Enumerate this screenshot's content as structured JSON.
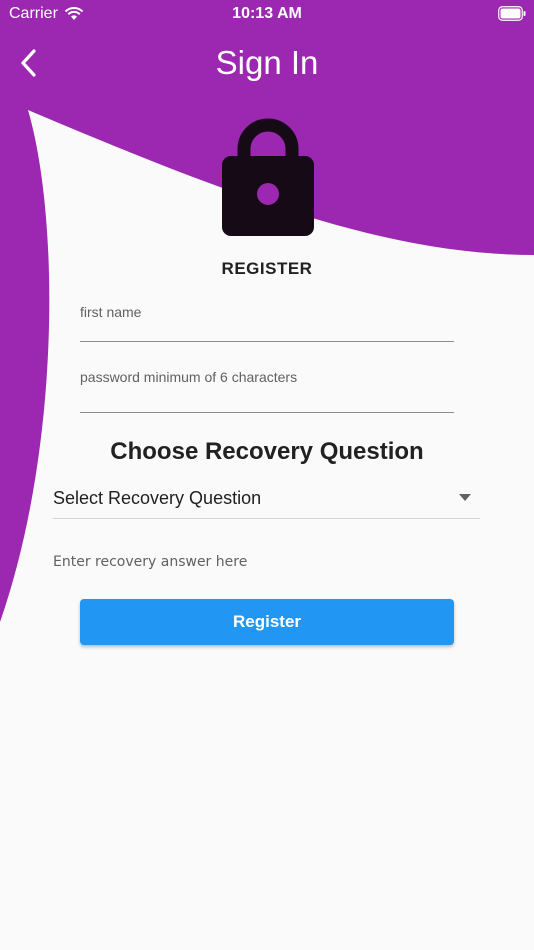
{
  "status_bar": {
    "carrier": "Carrier",
    "time": "10:13 AM",
    "wifi_icon": "wifi-icon",
    "battery_icon": "battery-icon"
  },
  "nav": {
    "title": "Sign In",
    "back_icon": "chevron-left-icon"
  },
  "form": {
    "heading": "REGISTER",
    "first_name_label": "first name",
    "password_label": "password minimum of 6 characters",
    "recovery_title": "Choose Recovery Question",
    "recovery_select_value": "Select Recovery Question",
    "recovery_answer_placeholder": "Enter recovery answer here",
    "register_button_label": "Register"
  },
  "colors": {
    "header_purple": "#9c27b0",
    "button_blue": "#2196f3",
    "lock_icon": "#150a16"
  }
}
